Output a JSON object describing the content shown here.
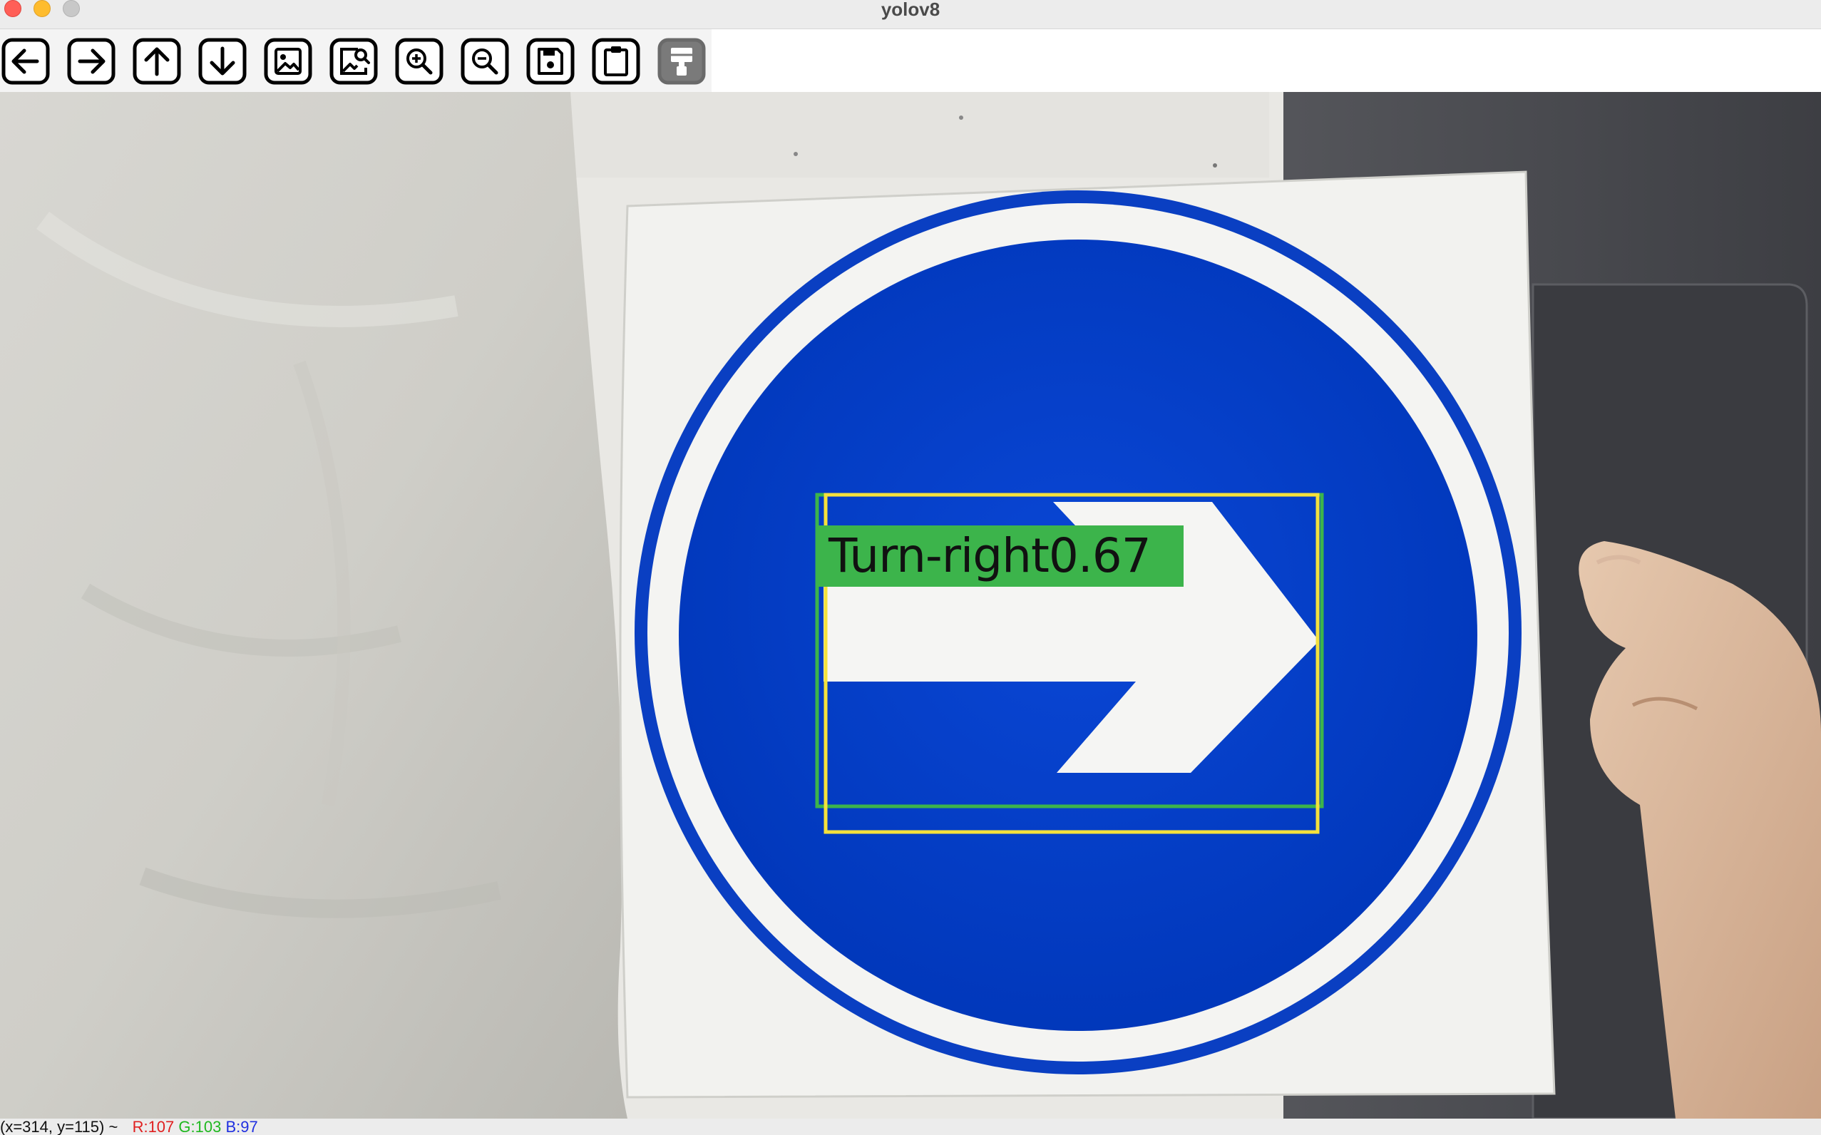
{
  "window": {
    "title": "yolov8"
  },
  "toolbar": {
    "buttons": [
      {
        "name": "back-button",
        "icon": "arrow-left-icon"
      },
      {
        "name": "forward-button",
        "icon": "arrow-right-icon"
      },
      {
        "name": "pan-up-button",
        "icon": "arrow-up-icon"
      },
      {
        "name": "pan-down-button",
        "icon": "arrow-down-icon"
      },
      {
        "name": "image-button",
        "icon": "image-icon"
      },
      {
        "name": "image-search-button",
        "icon": "image-search-icon"
      },
      {
        "name": "zoom-in-button",
        "icon": "zoom-in-icon"
      },
      {
        "name": "zoom-out-button",
        "icon": "zoom-out-icon"
      },
      {
        "name": "save-button",
        "icon": "save-icon"
      },
      {
        "name": "copy-clipboard-button",
        "icon": "clipboard-icon"
      },
      {
        "name": "properties-button",
        "icon": "paint-brush-icon"
      }
    ]
  },
  "detection": {
    "label": "Turn-right0.67",
    "box_color": "#3cb44b",
    "second_box_color": "#f5e13c"
  },
  "status": {
    "coords": "(x=314, y=115) ~",
    "r": "R:107",
    "g": "G:103",
    "b": "B:97",
    "r_color": "#e02020",
    "g_color": "#1fb81f",
    "b_color": "#2030e0"
  }
}
